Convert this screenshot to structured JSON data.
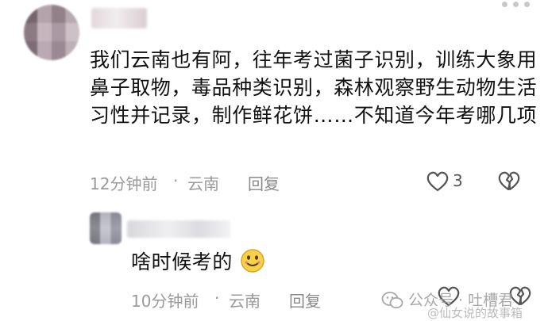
{
  "comment1": {
    "text": "我们云南也有阿，往年考过菌子识别，训练大象用鼻子取物，毒品种类识别，森林观察野生动物生活习性并记录，制作鲜花饼……不知道今年考哪几项",
    "time": "12分钟前",
    "separator": "·",
    "location": "云南",
    "reply_label": "回复",
    "like_count": "3"
  },
  "reply1": {
    "text": "啥时候考的",
    "time": "10分钟前",
    "separator": "·",
    "location": "云南",
    "reply_label": "回复"
  },
  "watermark": {
    "text": "公众号 · 吐槽君",
    "sub": "@仙女说的故事箱"
  },
  "icons": {
    "more": "more-dots-icon",
    "like": "heart-outline-icon",
    "dislike": "broken-heart-icon",
    "emoji": "smile-emoji-icon",
    "watermark_logo": "wechat-icon"
  }
}
